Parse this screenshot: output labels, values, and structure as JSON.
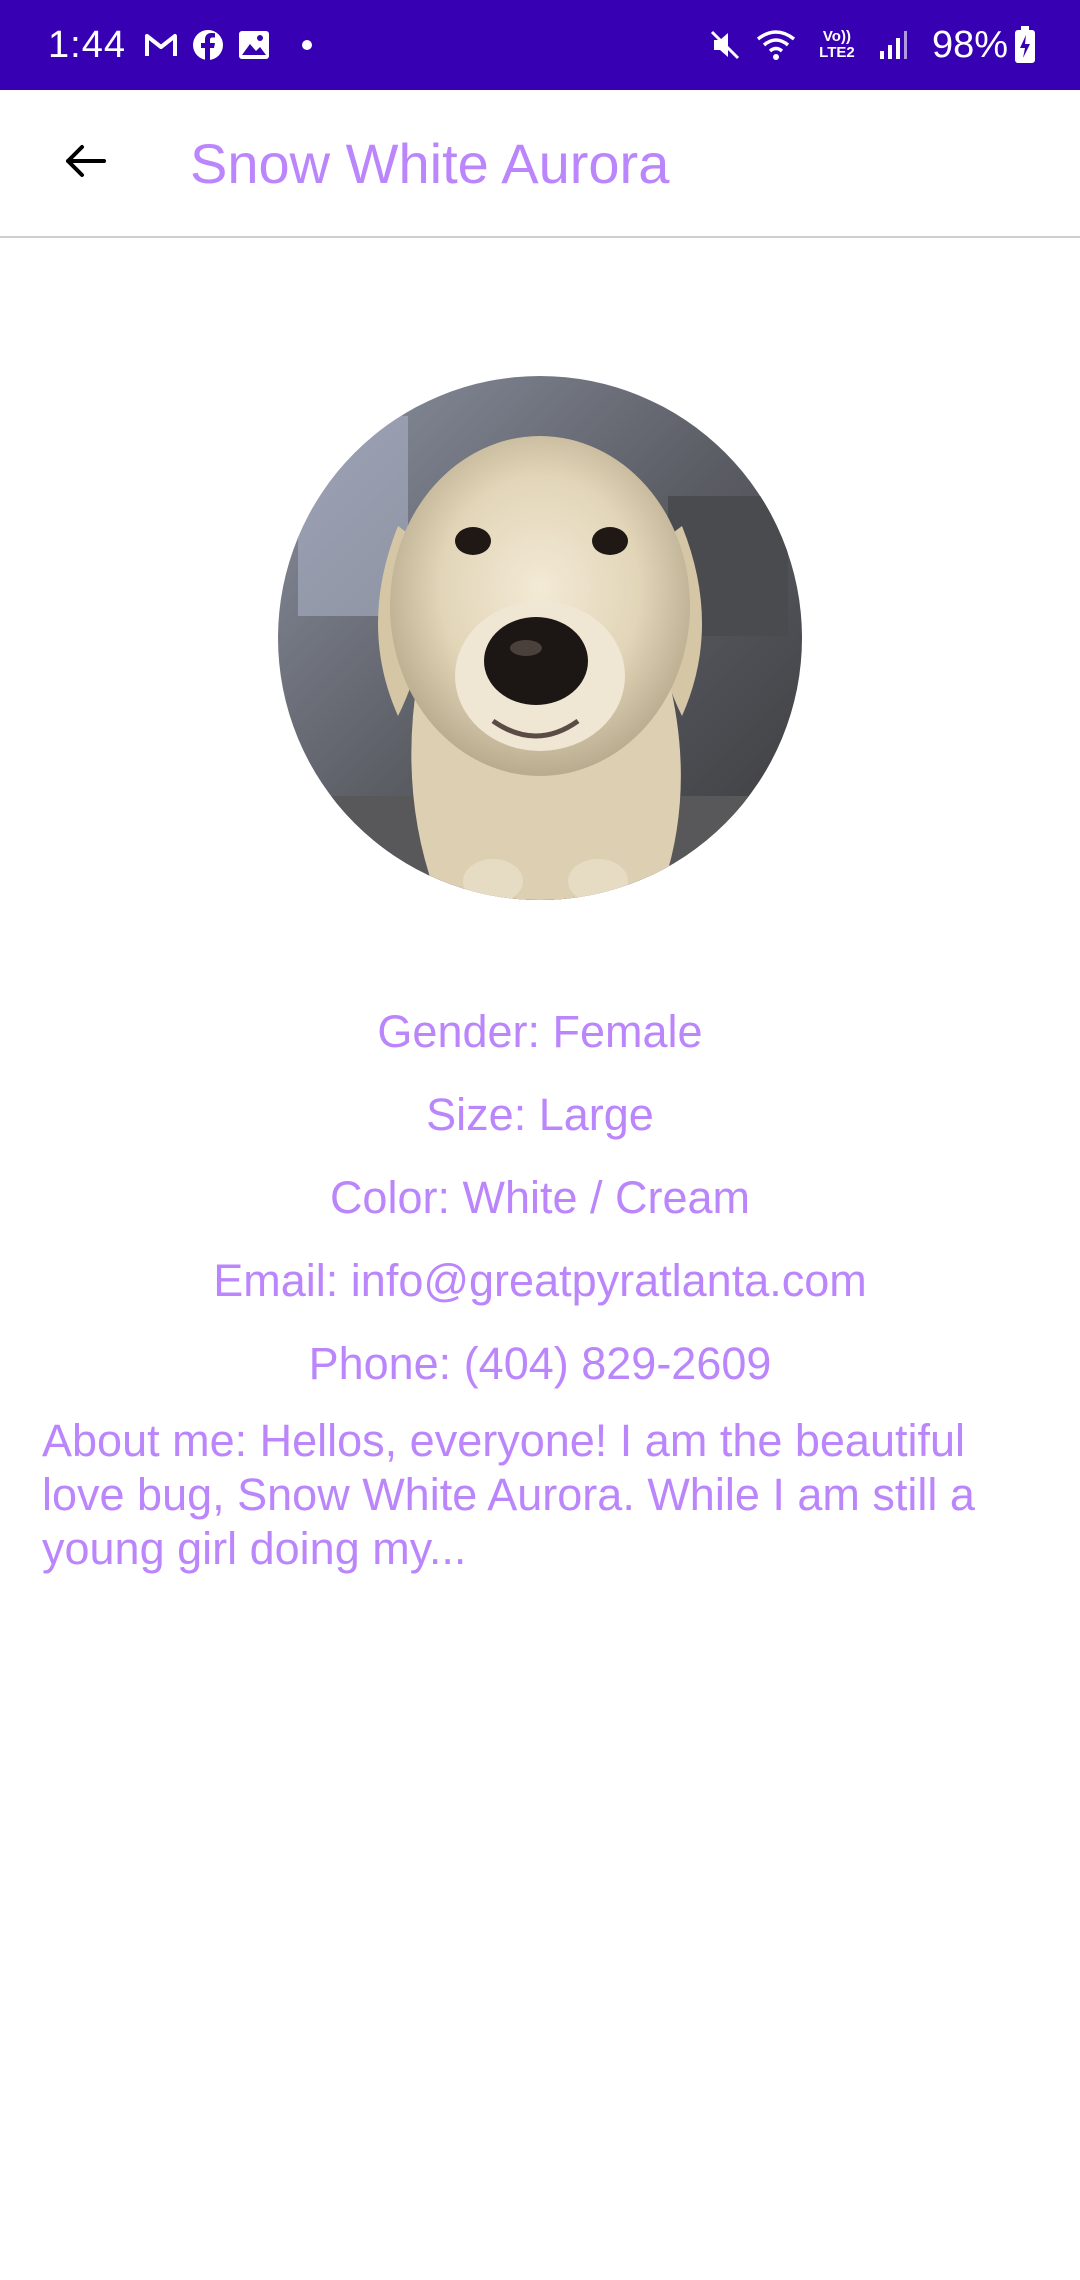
{
  "status_bar": {
    "time": "1:44",
    "battery": "98%",
    "network_label": "Vo)) LTE2",
    "icons": [
      "gmail-icon",
      "facebook-icon",
      "gallery-icon",
      "notification-dot-icon",
      "mute-icon",
      "wifi-icon",
      "lte-icon",
      "signal-icon",
      "battery-charging-icon"
    ],
    "background": "#3700b3"
  },
  "app_bar": {
    "title": "Snow White Aurora",
    "back_icon": "arrow-back-icon",
    "title_color": "#bb86fc"
  },
  "pet": {
    "photo": "dog-photo",
    "gender": "Gender: Female",
    "size": "Size: Large",
    "color": "Color: White / Cream",
    "email": "Email: info@greatpyratlanta.com",
    "phone": "Phone: (404) 829-2609",
    "about": "About me: Hellos, everyone! I am the beautiful love bug, Snow White Aurora. While I am still a young girl doing my..."
  },
  "colors": {
    "accent": "#bb86fc",
    "status_bar": "#3700b3"
  }
}
